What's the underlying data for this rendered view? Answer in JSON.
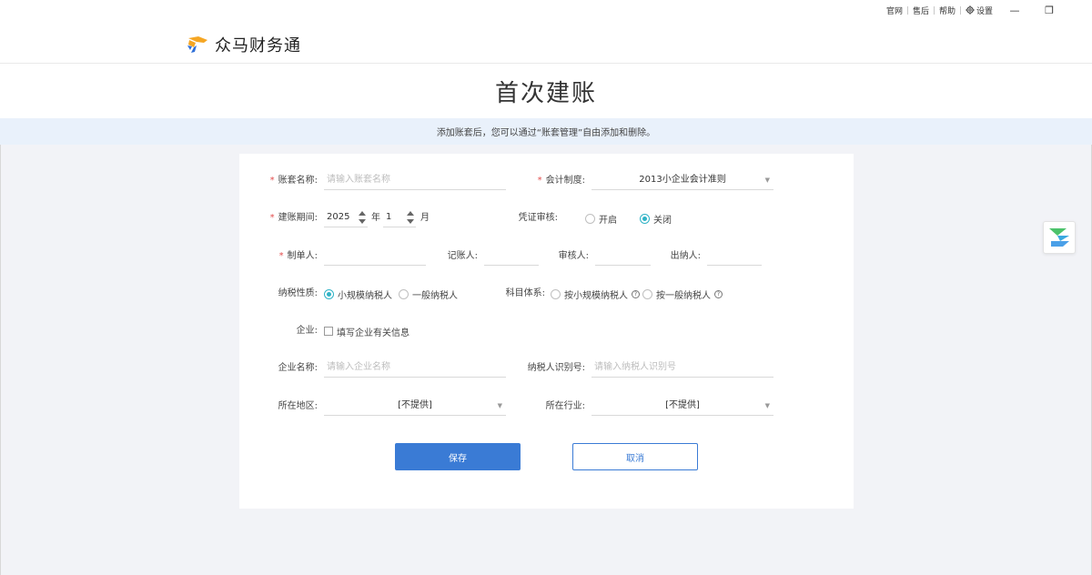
{
  "titlebar": {
    "links": [
      "官网",
      "售后",
      "帮助"
    ],
    "settings_label": "设置",
    "minimize_glyph": "—",
    "restore_glyph": "❐"
  },
  "app": {
    "name": "众马财务通"
  },
  "page": {
    "title": "首次建账",
    "notice": "添加账套后，您可以通过“账套管理”自由添加和删除。"
  },
  "form": {
    "required_mark": "*",
    "account_name": {
      "label": "账套名称:",
      "placeholder": "请输入账套名称",
      "value": ""
    },
    "accounting_system": {
      "label": "会计制度:",
      "value": "2013小企业会计准则"
    },
    "period": {
      "label": "建账期间:",
      "year": "2025",
      "year_unit": "年",
      "month": "1",
      "month_unit": "月"
    },
    "voucher_review": {
      "label": "凭证审核:",
      "options": [
        "开启",
        "关闭"
      ],
      "selected": "关闭"
    },
    "preparer": {
      "label": "制单人:",
      "value": ""
    },
    "bookkeeper": {
      "label": "记账人:",
      "value": ""
    },
    "reviewer": {
      "label": "审核人:",
      "value": ""
    },
    "cashier": {
      "label": "出纳人:",
      "value": ""
    },
    "tax_type": {
      "label": "纳税性质:",
      "options": [
        "小规模纳税人",
        "一般纳税人"
      ],
      "selected": "小规模纳税人"
    },
    "subject_system": {
      "label": "科目体系:",
      "options": [
        "按小规模纳税人",
        "按一般纳税人"
      ],
      "selected": ""
    },
    "help_glyph": "?",
    "enterprise": {
      "label": "企业:",
      "checkbox_label": "填写企业有关信息",
      "checked": false
    },
    "enterprise_name": {
      "label": "企业名称:",
      "placeholder": "请输入企业名称",
      "value": ""
    },
    "taxpayer_id": {
      "label": "纳税人识别号:",
      "placeholder": "请输入纳税人识别号",
      "value": ""
    },
    "region": {
      "label": "所在地区:",
      "value": "[不提供]"
    },
    "industry": {
      "label": "所在行业:",
      "value": "[不提供]"
    }
  },
  "buttons": {
    "save": "保存",
    "cancel": "取消"
  },
  "colors": {
    "primary": "#3a7bd5",
    "radio_accent": "#2fb3c6",
    "required": "#e34d4d",
    "notice_bg": "#e9f1fb",
    "page_bg": "#f2f3f7"
  }
}
